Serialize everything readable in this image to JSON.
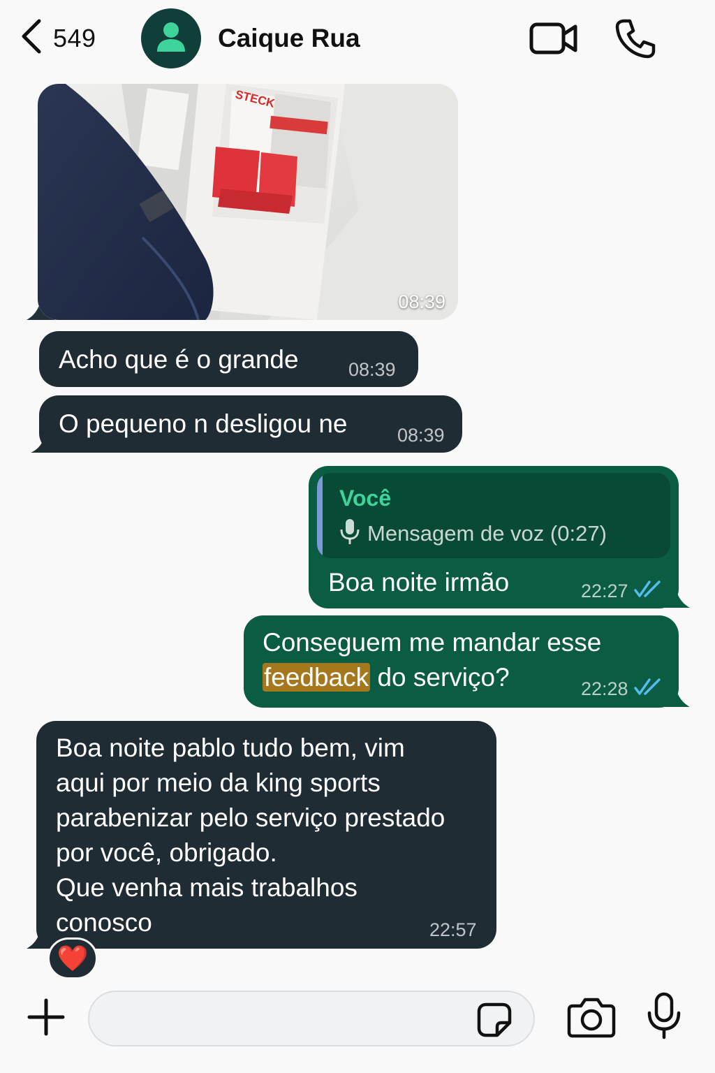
{
  "header": {
    "back_count": "549",
    "contact_name": "Caique Rua"
  },
  "messages": [
    {
      "type": "image",
      "direction": "incoming",
      "time": "08:39",
      "image_text": "STECK"
    },
    {
      "type": "text",
      "direction": "incoming",
      "text": "Acho que é o grande",
      "time": "08:39"
    },
    {
      "type": "text",
      "direction": "incoming",
      "text": "O pequeno n desligou ne",
      "time": "08:39"
    },
    {
      "type": "reply",
      "direction": "outgoing",
      "quoted_author": "Você",
      "quoted_text": "Mensagem de voz (0:27)",
      "text": "Boa noite irmão",
      "time": "22:27",
      "status": "read"
    },
    {
      "type": "text",
      "direction": "outgoing",
      "text_line1": "Conseguem me mandar esse",
      "highlight_word": "feedback",
      "text_line2_rest": " do serviço?",
      "time": "22:28",
      "status": "read"
    },
    {
      "type": "text",
      "direction": "incoming",
      "text": "Boa noite pablo tudo bem, vim\naqui por meio da king sports\nparabenizar pelo serviço prestado\npor você, obrigado.\nQue venha mais trabalhos\nconosco",
      "time": "22:57",
      "reaction": "❤️"
    }
  ],
  "composer": {
    "placeholder": ""
  },
  "colors": {
    "incoming_bubble": "#1f2c33",
    "outgoing_bubble": "#0a5c43",
    "quote_author": "#3fd39c",
    "read_ticks": "#53bdeb",
    "highlight": "#a6781e"
  },
  "icons": [
    "chevron-left-icon",
    "person-icon",
    "video-camera-icon",
    "phone-icon",
    "microphone-icon",
    "double-check-icon",
    "plus-icon",
    "sticker-icon",
    "camera-icon",
    "mic-icon"
  ]
}
